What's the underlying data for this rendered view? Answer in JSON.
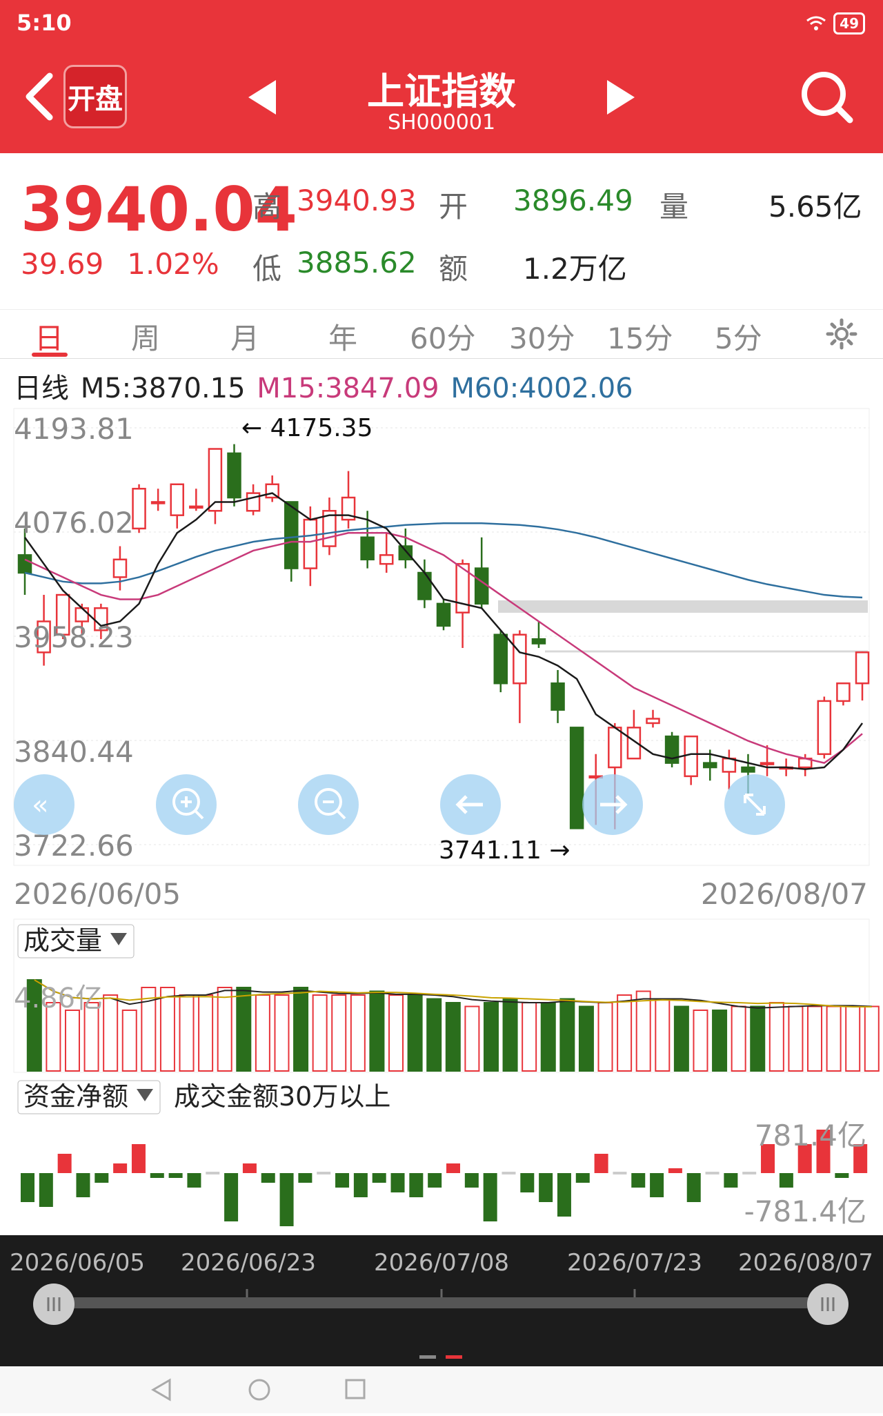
{
  "status": {
    "time": "5:10",
    "battery": "49"
  },
  "header": {
    "logo_text": "开盘",
    "title": "上证指数",
    "code": "SH000001"
  },
  "quote": {
    "price": "3940.04",
    "change": "39.69",
    "change_pct": "1.02%",
    "high_label": "高",
    "high": "3940.93",
    "low_label": "低",
    "low": "3885.62",
    "open_label": "开",
    "open": "3896.49",
    "amount_label": "额",
    "amount": "1.2万亿",
    "volume_label": "量",
    "volume": "5.65亿"
  },
  "tabs": [
    "日",
    "周",
    "月",
    "年",
    "60分",
    "30分",
    "15分",
    "5分"
  ],
  "ma": {
    "label": "日线",
    "m5": "M5:3870.15",
    "m15": "M15:3847.09",
    "m60": "M60:4002.06"
  },
  "colors": {
    "up": "#e8343a",
    "down": "#2a6e1c",
    "m5": "#1a1a1a",
    "m15": "#c83a7a",
    "m60": "#2e6f9e"
  },
  "price_axis": {
    "labels": [
      "4193.81",
      "4076.02",
      "3958.23",
      "3840.44",
      "3722.66"
    ]
  },
  "annotations": {
    "high": "← 4175.35",
    "low": "3741.11 →"
  },
  "date_range": {
    "start": "2026/06/05",
    "end": "2026/08/07"
  },
  "volume_panel": {
    "label": "成交量",
    "value": "4.86亿"
  },
  "fund_panel": {
    "label": "资金净额",
    "desc": "成交金额30万以上",
    "top": "781.4亿",
    "bottom": "-781.4亿"
  },
  "timeline": {
    "dates": [
      "2026/06/05",
      "2026/06/23",
      "2026/07/08",
      "2026/07/23",
      "2026/08/07"
    ]
  },
  "chart_data": {
    "type": "candlestick",
    "ylim": [
      3722.66,
      4193.81
    ],
    "candles": [
      {
        "o": 4050,
        "c": 4030,
        "h": 4080,
        "l": 4005
      },
      {
        "o": 3940,
        "c": 3975,
        "h": 4005,
        "l": 3925
      },
      {
        "o": 3960,
        "c": 4005,
        "h": 4005,
        "l": 3955
      },
      {
        "o": 3975,
        "c": 3990,
        "h": 3995,
        "l": 3960
      },
      {
        "o": 3965,
        "c": 3990,
        "h": 3995,
        "l": 3955
      },
      {
        "o": 4025,
        "c": 4045,
        "h": 4060,
        "l": 4010
      },
      {
        "o": 4080,
        "c": 4125,
        "h": 4130,
        "l": 4075
      },
      {
        "o": 4110,
        "c": 4110,
        "h": 4125,
        "l": 4100
      },
      {
        "o": 4095,
        "c": 4130,
        "h": 4130,
        "l": 4080
      },
      {
        "o": 4105,
        "c": 4105,
        "h": 4125,
        "l": 4100
      },
      {
        "o": 4100,
        "c": 4170,
        "h": 4170,
        "l": 4085
      },
      {
        "o": 4165,
        "c": 4115,
        "h": 4175.35,
        "l": 4105
      },
      {
        "o": 4100,
        "c": 4120,
        "h": 4130,
        "l": 4095
      },
      {
        "o": 4115,
        "c": 4130,
        "h": 4140,
        "l": 4110
      },
      {
        "o": 4110,
        "c": 4035,
        "h": 4110,
        "l": 4020
      },
      {
        "o": 4035,
        "c": 4090,
        "h": 4105,
        "l": 4015
      },
      {
        "o": 4060,
        "c": 4100,
        "h": 4115,
        "l": 4050
      },
      {
        "o": 4090,
        "c": 4115,
        "h": 4145,
        "l": 4080
      },
      {
        "o": 4070,
        "c": 4045,
        "h": 4100,
        "l": 4035
      },
      {
        "o": 4040,
        "c": 4050,
        "h": 4075,
        "l": 4030
      },
      {
        "o": 4060,
        "c": 4045,
        "h": 4080,
        "l": 4035
      },
      {
        "o": 4030,
        "c": 4000,
        "h": 4045,
        "l": 3990
      },
      {
        "o": 3995,
        "c": 3970,
        "h": 4000,
        "l": 3965
      },
      {
        "o": 3985,
        "c": 4040,
        "h": 4045,
        "l": 3945
      },
      {
        "o": 4035,
        "c": 3995,
        "h": 4070,
        "l": 3990
      },
      {
        "o": 3960,
        "c": 3905,
        "h": 3965,
        "l": 3895
      },
      {
        "o": 3905,
        "c": 3960,
        "h": 3965,
        "l": 3860
      },
      {
        "o": 3955,
        "c": 3950,
        "h": 3975,
        "l": 3945
      },
      {
        "o": 3905,
        "c": 3875,
        "h": 3920,
        "l": 3860
      },
      {
        "o": 3855,
        "c": 3741.11,
        "h": 3855,
        "l": 3745
      },
      {
        "o": 3800,
        "c": 3800,
        "h": 3825,
        "l": 3745
      },
      {
        "o": 3810,
        "c": 3855,
        "h": 3860,
        "l": 3740
      },
      {
        "o": 3820,
        "c": 3855,
        "h": 3875,
        "l": 3820
      },
      {
        "o": 3860,
        "c": 3865,
        "h": 3875,
        "l": 3855
      },
      {
        "o": 3845,
        "c": 3815,
        "h": 3850,
        "l": 3810
      },
      {
        "o": 3800,
        "c": 3845,
        "h": 3845,
        "l": 3790
      },
      {
        "o": 3815,
        "c": 3810,
        "h": 3830,
        "l": 3795
      },
      {
        "o": 3805,
        "c": 3820,
        "h": 3830,
        "l": 3785
      },
      {
        "o": 3810,
        "c": 3805,
        "h": 3825,
        "l": 3780
      },
      {
        "o": 3815,
        "c": 3815,
        "h": 3835,
        "l": 3800
      },
      {
        "o": 3810,
        "c": 3810,
        "h": 3820,
        "l": 3800
      },
      {
        "o": 3810,
        "c": 3820,
        "h": 3825,
        "l": 3800
      },
      {
        "o": 3825,
        "c": 3885,
        "h": 3890,
        "l": 3820
      },
      {
        "o": 3885,
        "c": 3905,
        "h": 3905,
        "l": 3880
      },
      {
        "o": 3905,
        "c": 3940.04,
        "h": 3940.93,
        "l": 3885.62
      }
    ],
    "ma5": [
      4070,
      4040,
      4010,
      3990,
      3970,
      3975,
      3995,
      4040,
      4075,
      4090,
      4110,
      4110,
      4115,
      4120,
      4105,
      4090,
      4095,
      4095,
      4090,
      4080,
      4055,
      4030,
      4000,
      3995,
      3990,
      3965,
      3940,
      3935,
      3925,
      3910,
      3870,
      3855,
      3840,
      3825,
      3820,
      3825,
      3825,
      3820,
      3815,
      3810,
      3810,
      3808,
      3810,
      3830,
      3860
    ],
    "ma15": [
      4045,
      4035,
      4025,
      4015,
      4005,
      4000,
      4000,
      4005,
      4015,
      4025,
      4035,
      4045,
      4055,
      4060,
      4065,
      4065,
      4070,
      4075,
      4075,
      4075,
      4070,
      4060,
      4050,
      4035,
      4020,
      4005,
      3990,
      3975,
      3960,
      3945,
      3930,
      3915,
      3900,
      3890,
      3880,
      3870,
      3860,
      3850,
      3840,
      3832,
      3825,
      3820,
      3815,
      3830,
      3848
    ],
    "ma60": [
      4030,
      4025,
      4020,
      4018,
      4018,
      4020,
      4025,
      4032,
      4040,
      4048,
      4055,
      4060,
      4065,
      4068,
      4070,
      4072,
      4075,
      4078,
      4080,
      4082,
      4084,
      4085,
      4086,
      4086,
      4086,
      4085,
      4084,
      4082,
      4079,
      4075,
      4070,
      4064,
      4058,
      4052,
      4046,
      4040,
      4034,
      4028,
      4022,
      4017,
      4013,
      4009,
      4005,
      4003,
      4002
    ],
    "volume": [
      1.2,
      0.9,
      0.8,
      0.9,
      1.0,
      0.8,
      1.1,
      1.1,
      1.0,
      1.0,
      1.1,
      1.1,
      1.0,
      1.0,
      1.1,
      1.0,
      1.0,
      1.0,
      1.05,
      1.0,
      1.0,
      0.95,
      0.9,
      0.85,
      0.9,
      0.95,
      0.9,
      0.9,
      0.95,
      0.85,
      0.9,
      1.0,
      1.05,
      0.95,
      0.85,
      0.8,
      0.8,
      0.85,
      0.85,
      0.9,
      0.85,
      0.85,
      0.85,
      0.85,
      0.85
    ],
    "fund_flow": [
      -0.6,
      -0.7,
      0.4,
      -0.5,
      -0.2,
      0.2,
      0.6,
      -0.1,
      -0.1,
      -0.3,
      0.0,
      -1.0,
      0.2,
      -0.2,
      -1.1,
      -0.2,
      0.0,
      -0.3,
      -0.5,
      -0.2,
      -0.4,
      -0.5,
      -0.3,
      0.2,
      -0.3,
      -1.0,
      0.0,
      -0.4,
      -0.6,
      -0.9,
      -0.2,
      0.4,
      0.0,
      -0.3,
      -0.5,
      0.1,
      -0.6,
      0.0,
      -0.3,
      0.0,
      0.6,
      -0.3,
      0.6,
      0.9,
      -0.1,
      0.6
    ]
  }
}
